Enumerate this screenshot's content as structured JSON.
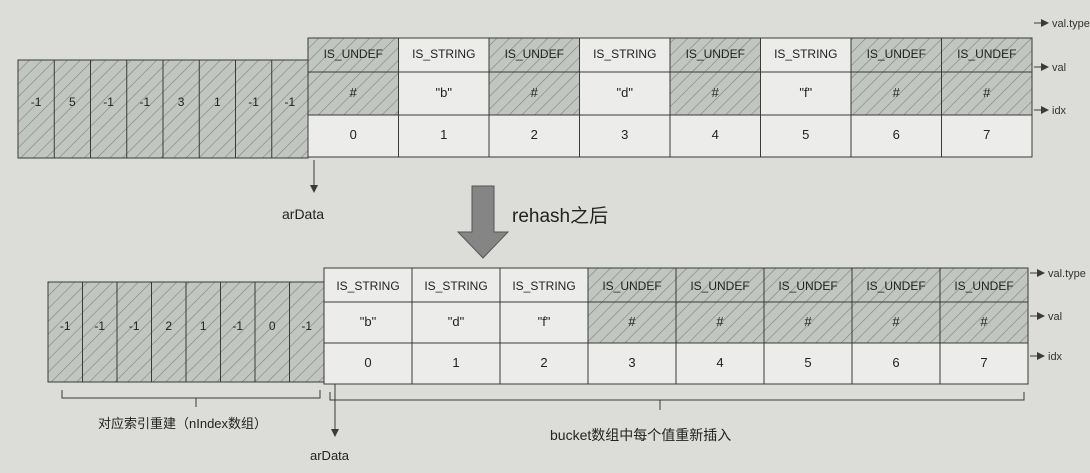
{
  "top": {
    "index_values": [
      "-1",
      "5",
      "-1",
      "-1",
      "3",
      "1",
      "-1",
      "-1"
    ],
    "buckets": [
      {
        "type": "IS_UNDEF",
        "val": "#",
        "idx": "0"
      },
      {
        "type": "IS_STRING",
        "val": "\"b\"",
        "idx": "1"
      },
      {
        "type": "IS_UNDEF",
        "val": "#",
        "idx": "2"
      },
      {
        "type": "IS_STRING",
        "val": "\"d\"",
        "idx": "3"
      },
      {
        "type": "IS_UNDEF",
        "val": "#",
        "idx": "4"
      },
      {
        "type": "IS_STRING",
        "val": "\"f\"",
        "idx": "5"
      },
      {
        "type": "IS_UNDEF",
        "val": "#",
        "idx": "6"
      },
      {
        "type": "IS_UNDEF",
        "val": "#",
        "idx": "7"
      }
    ],
    "row_labels": [
      "val.type",
      "val",
      "idx"
    ],
    "pointer_label": "arData"
  },
  "transition_label": "rehash之后",
  "bottom": {
    "index_values": [
      "-1",
      "-1",
      "-1",
      "2",
      "1",
      "-1",
      "0",
      "-1"
    ],
    "buckets": [
      {
        "type": "IS_STRING",
        "val": "\"b\"",
        "idx": "0"
      },
      {
        "type": "IS_STRING",
        "val": "\"d\"",
        "idx": "1"
      },
      {
        "type": "IS_STRING",
        "val": "\"f\"",
        "idx": "2"
      },
      {
        "type": "IS_UNDEF",
        "val": "#",
        "idx": "3"
      },
      {
        "type": "IS_UNDEF",
        "val": "#",
        "idx": "4"
      },
      {
        "type": "IS_UNDEF",
        "val": "#",
        "idx": "5"
      },
      {
        "type": "IS_UNDEF",
        "val": "#",
        "idx": "6"
      },
      {
        "type": "IS_UNDEF",
        "val": "#",
        "idx": "7"
      }
    ],
    "row_labels": [
      "val.type",
      "val",
      "idx"
    ],
    "pointer_label": "arData",
    "index_caption": "对应索引重建（nIndex数组）",
    "bucket_caption": "bucket数组中每个值重新插入"
  },
  "colors": {
    "paper": "#dcdcd8",
    "cell": "#ececea",
    "hatch_bg": "#c2c6c0",
    "hatch_line": "#7d847d",
    "line": "#3a3a3a",
    "arrow_fill": "#858585"
  }
}
